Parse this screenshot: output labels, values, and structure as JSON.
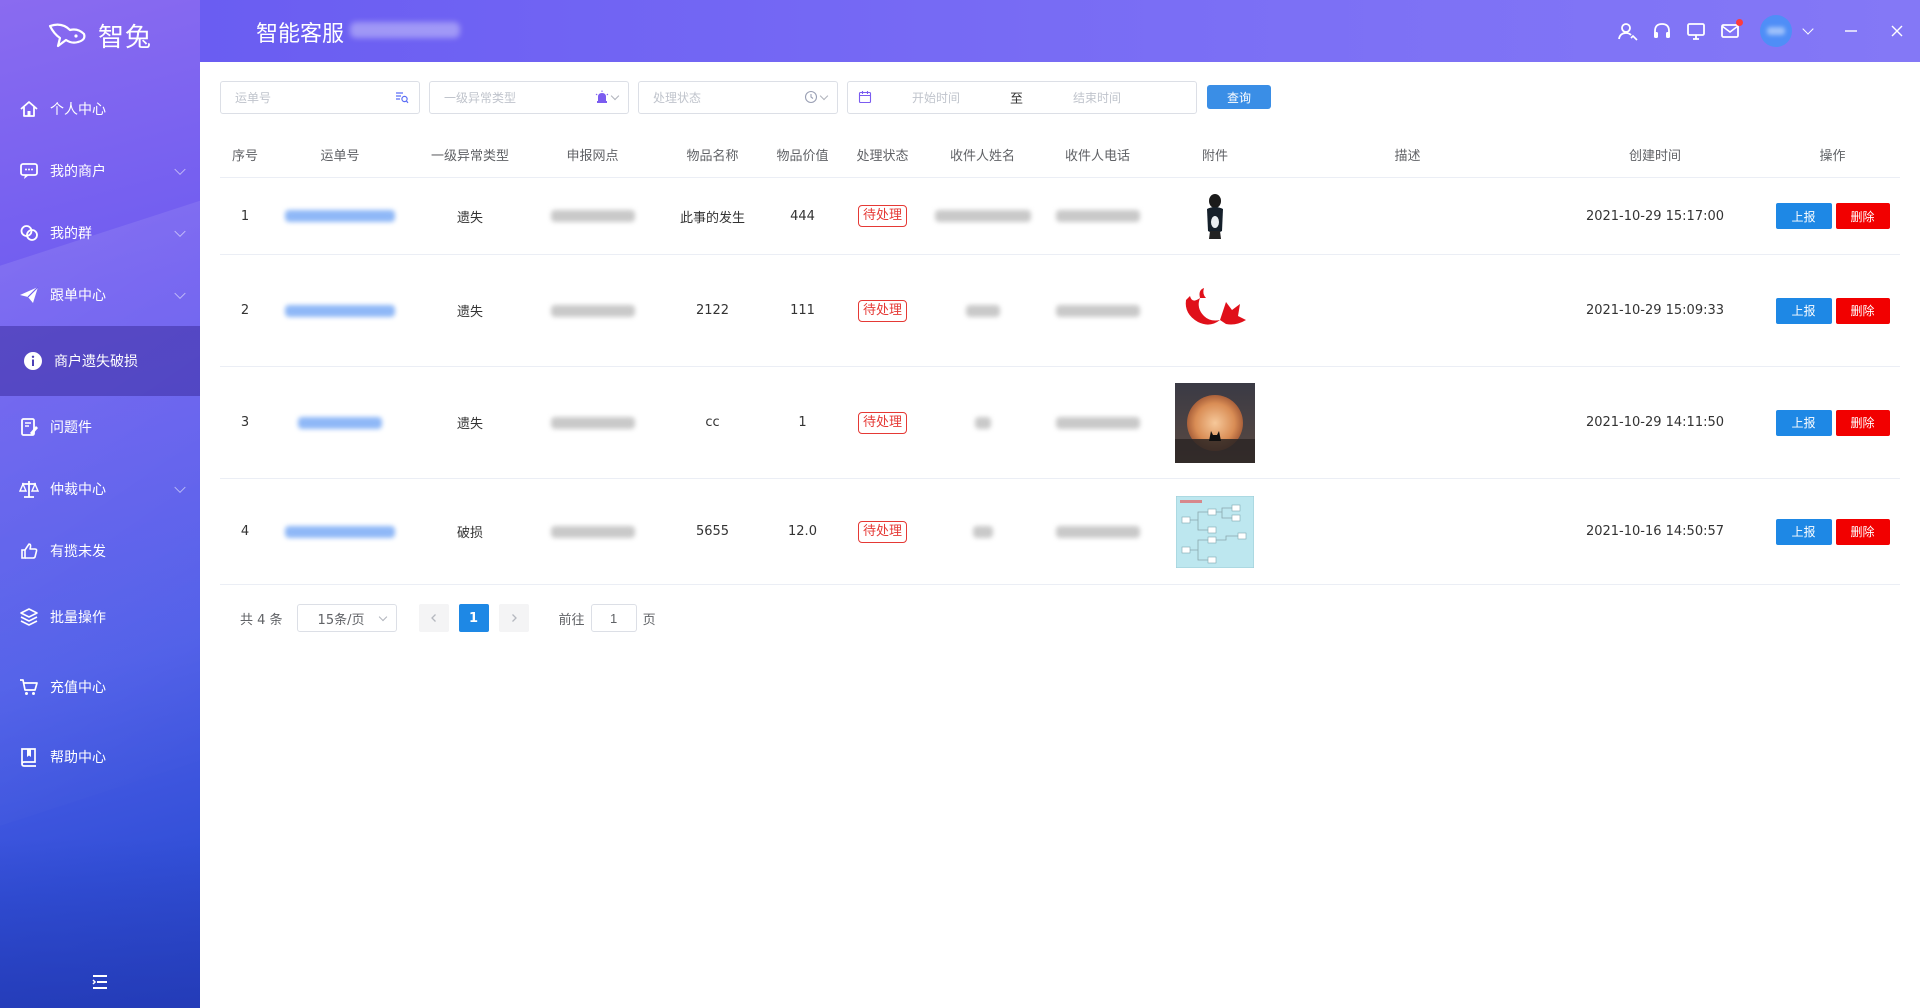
{
  "app": {
    "logo_text": "智兔",
    "title": "智能客服"
  },
  "sidebar": {
    "items": [
      {
        "label": "个人中心",
        "icon": "home-icon",
        "has_arrow": false,
        "active": false
      },
      {
        "label": "我的商户",
        "icon": "chat-icon",
        "has_arrow": true,
        "active": false
      },
      {
        "label": "我的群",
        "icon": "group-chat-icon",
        "has_arrow": true,
        "active": false
      },
      {
        "label": "跟单中心",
        "icon": "paper-plane-icon",
        "has_arrow": true,
        "active": false
      },
      {
        "label": "商户遗失破损",
        "icon": "info-icon",
        "has_arrow": false,
        "active": true
      },
      {
        "label": "问题件",
        "icon": "edit-note-icon",
        "has_arrow": false,
        "active": false
      },
      {
        "label": "仲裁中心",
        "icon": "scale-icon",
        "has_arrow": true,
        "active": false
      },
      {
        "label": "有揽未发",
        "icon": "thumbs-up-icon",
        "has_arrow": false,
        "active": false
      },
      {
        "label": "批量操作",
        "icon": "layers-icon",
        "has_arrow": false,
        "active": false
      },
      {
        "label": "充值中心",
        "icon": "cart-icon",
        "has_arrow": false,
        "active": false
      },
      {
        "label": "帮助中心",
        "icon": "book-icon",
        "has_arrow": false,
        "active": false
      }
    ]
  },
  "filters": {
    "waybill_placeholder": "运单号",
    "exception_type_placeholder": "一级异常类型",
    "status_placeholder": "处理状态",
    "start_placeholder": "开始时间",
    "range_separator": "至",
    "end_placeholder": "结束时间",
    "query_label": "查询"
  },
  "table": {
    "headers": [
      "序号",
      "运单号",
      "一级异常类型",
      "申报网点",
      "物品名称",
      "物品价值",
      "处理状态",
      "收件人姓名",
      "收件人电话",
      "附件",
      "描述",
      "创建时间",
      "操作"
    ],
    "rows": [
      {
        "index": "1",
        "type": "遗失",
        "item_name": "此事的发生",
        "item_value": "444",
        "status": "待处理",
        "attachment": "figure-photo",
        "description": "",
        "created": "2021-10-29 15:17:00"
      },
      {
        "index": "2",
        "type": "遗失",
        "item_name": "2122",
        "item_value": "111",
        "status": "待处理",
        "attachment": "red-fox-logo",
        "description": "",
        "created": "2021-10-29 15:09:33"
      },
      {
        "index": "3",
        "type": "遗失",
        "item_name": "cc",
        "item_value": "1",
        "status": "待处理",
        "attachment": "sunset-cat-photo",
        "description": "",
        "created": "2021-10-29 14:11:50"
      },
      {
        "index": "4",
        "type": "破损",
        "item_name": "5655",
        "item_value": "12.0",
        "status": "待处理",
        "attachment": "flowchart-screenshot",
        "description": "",
        "created": "2021-10-16 14:50:57"
      }
    ],
    "report_label": "上报",
    "delete_label": "删除"
  },
  "pagination": {
    "total_text": "共 4 条",
    "page_size": "15条/页",
    "current_page": "1",
    "goto_label": "前往",
    "goto_value": "1",
    "page_unit": "页"
  },
  "colors": {
    "primary": "#1e88e5",
    "danger": "#f20000",
    "accent": "#6a5df2",
    "status_tag": "#e53935"
  }
}
